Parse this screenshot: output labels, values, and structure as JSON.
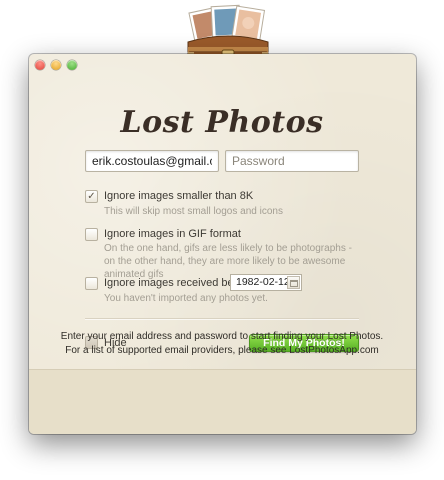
{
  "app": {
    "title": "Lost Photos"
  },
  "form": {
    "email": {
      "value": "erik.costoulas@gmail.com",
      "placeholder": ""
    },
    "password": {
      "value": "",
      "placeholder": "Password"
    }
  },
  "options": [
    {
      "label": "Ignore images smaller than 8K",
      "description": "This will skip most small logos and icons",
      "checked": true,
      "check_glyph": "✓"
    },
    {
      "label": "Ignore images in GIF format",
      "description": "On the one hand, gifs are less likely to be photographs - on the other hand, they are more likely to be awesome animated gifs",
      "checked": false
    },
    {
      "label": "Ignore images received before",
      "description": "You haven't imported any photos yet.",
      "checked": false,
      "date_value": "1982-02-12"
    }
  ],
  "hide": {
    "label": "Hide",
    "checked": false
  },
  "actions": {
    "find_label": "Find My Photos!"
  },
  "footer": {
    "line1": "Enter your email address and password to start finding your Lost Photos.",
    "line2": "For a list of supported email providers, please see LostPhotosApp.com"
  },
  "colors": {
    "window_bg": "#efe9d9",
    "footer_bg": "#e7dfc9",
    "accent_green": "#58b126",
    "title_text": "#3a2e26"
  },
  "icons": {
    "window_close": "traffic-light-close-icon",
    "window_minimize": "traffic-light-minimize-icon",
    "window_zoom": "traffic-light-zoom-icon",
    "app_logo": "treasure-chest-photos-icon",
    "date_picker": "calendar-icon"
  }
}
